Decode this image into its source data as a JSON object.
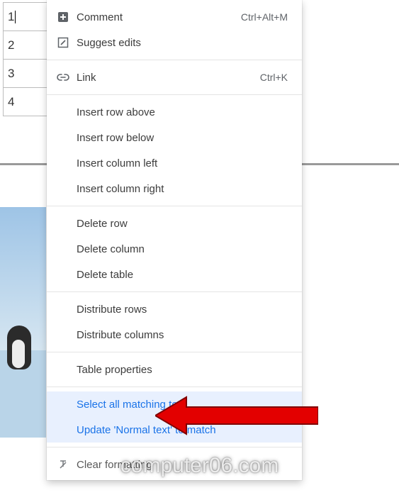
{
  "table": {
    "rows": [
      "1",
      "2",
      "3",
      "4"
    ]
  },
  "menu": {
    "comment": {
      "label": "Comment",
      "shortcut": "Ctrl+Alt+M"
    },
    "suggest": {
      "label": "Suggest edits"
    },
    "link": {
      "label": "Link",
      "shortcut": "Ctrl+K"
    },
    "insert_row_above": {
      "label": "Insert row above"
    },
    "insert_row_below": {
      "label": "Insert row below"
    },
    "insert_col_left": {
      "label": "Insert column left"
    },
    "insert_col_right": {
      "label": "Insert column right"
    },
    "delete_row": {
      "label": "Delete row"
    },
    "delete_column": {
      "label": "Delete column"
    },
    "delete_table": {
      "label": "Delete table"
    },
    "distribute_rows": {
      "label": "Distribute rows"
    },
    "distribute_columns": {
      "label": "Distribute columns"
    },
    "table_properties": {
      "label": "Table properties"
    },
    "select_matching": {
      "label": "Select all matching text"
    },
    "update_normal": {
      "label": "Update 'Normal text' to match"
    },
    "clear_formatting": {
      "label": "Clear formatting"
    }
  },
  "watermark": "computer06.com"
}
